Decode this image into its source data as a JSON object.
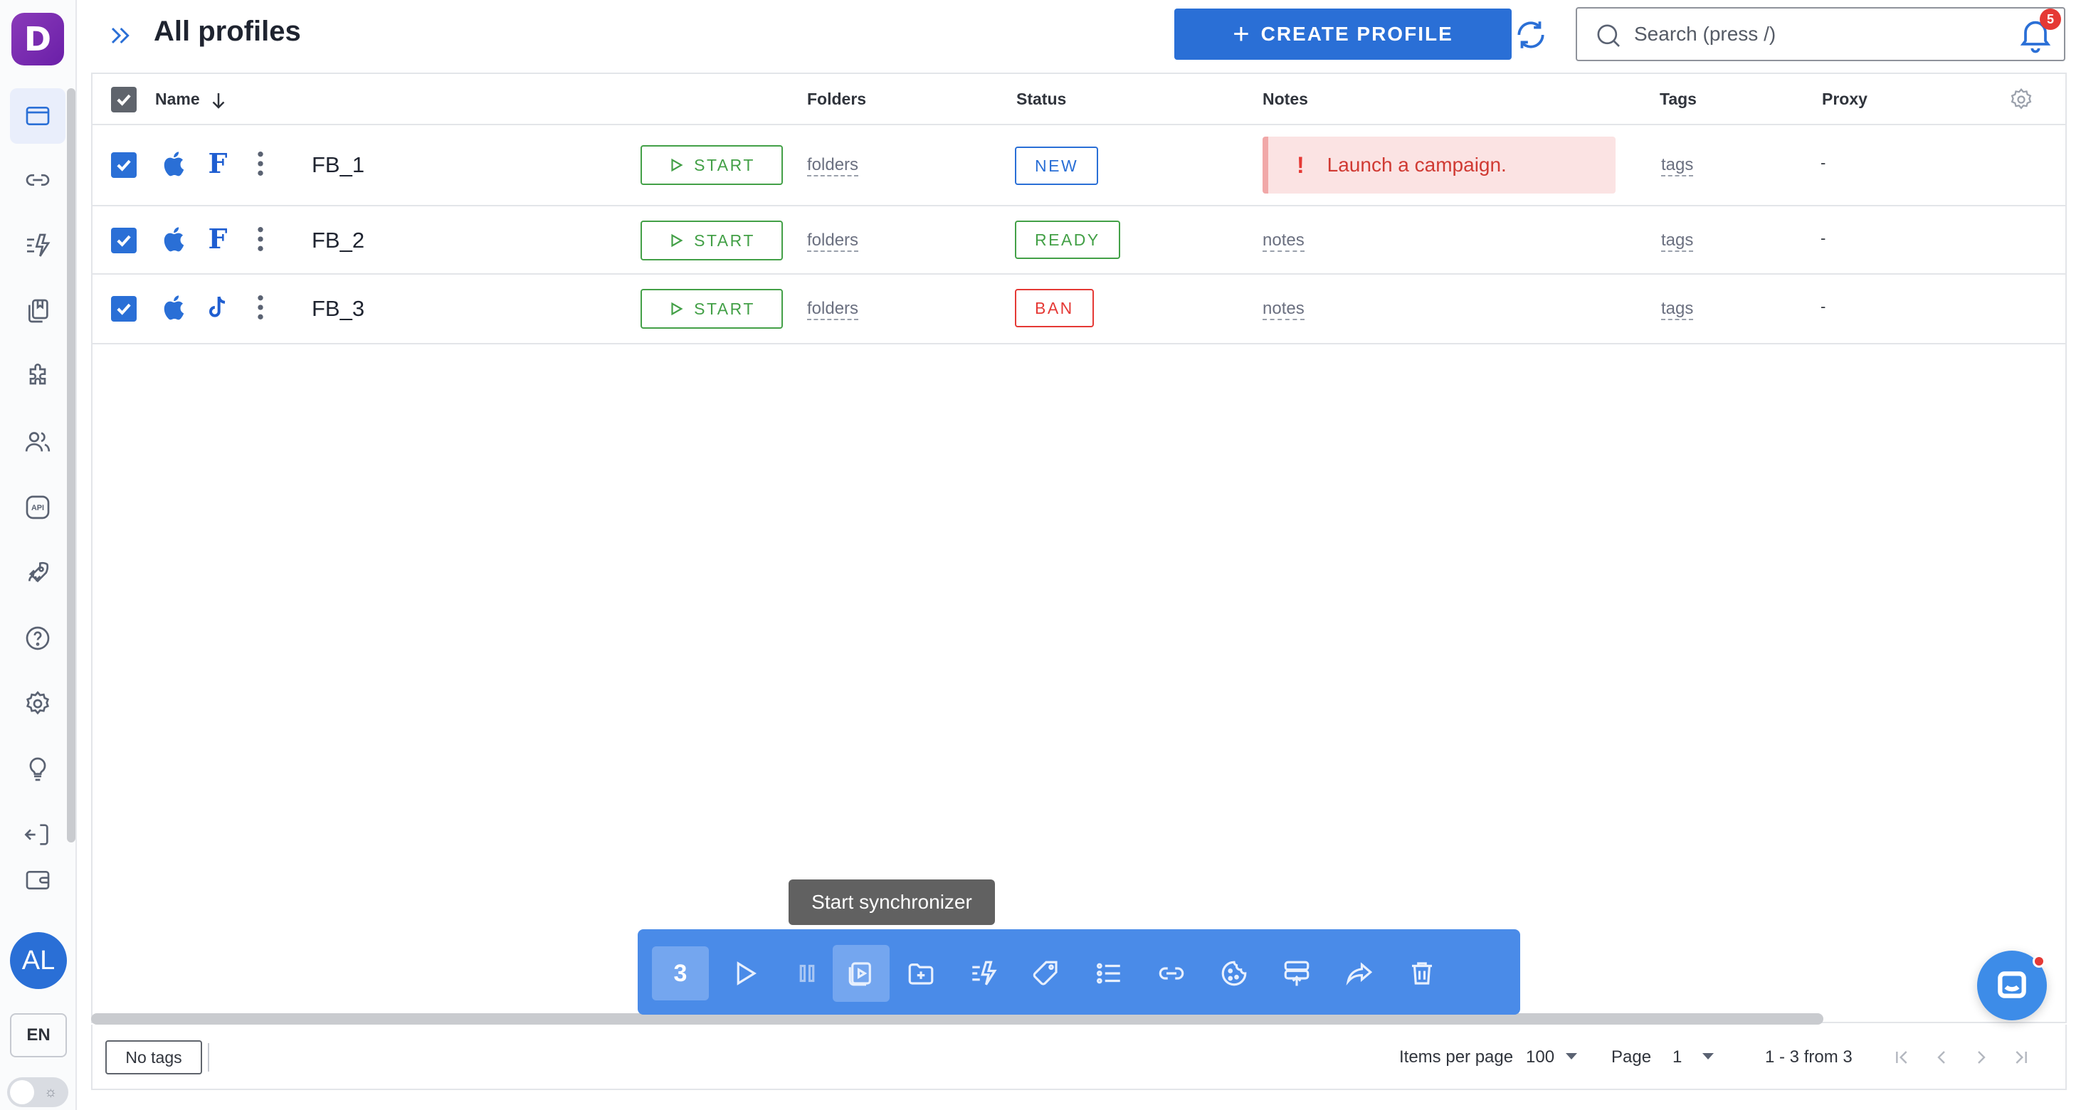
{
  "header": {
    "title": "All profiles",
    "create_button": "CREATE PROFILE",
    "search_placeholder": "Search (press /)",
    "notifications_count": "5"
  },
  "sidebar": {
    "logo": "D",
    "items": [
      "profiles-icon",
      "link-icon",
      "automation-icon",
      "templates-icon",
      "extensions-icon",
      "team-icon",
      "api-icon",
      "rocket-icon",
      "help-icon",
      "settings-icon",
      "lightbulb-icon",
      "logout-icon",
      "wallet-icon"
    ],
    "api_label": "API",
    "avatar": "AL",
    "language": "EN"
  },
  "table": {
    "columns": {
      "name": "Name",
      "folders": "Folders",
      "status": "Status",
      "notes": "Notes",
      "tags": "Tags",
      "proxy": "Proxy"
    },
    "rows": [
      {
        "name": "FB_1",
        "platform": "apple-icon",
        "social": "F",
        "start": "START",
        "folders": "folders",
        "status": "NEW",
        "status_color": "#2a6fd6",
        "note": "Launch a campaign.",
        "note_type": "alert",
        "tags": "tags",
        "proxy": "-"
      },
      {
        "name": "FB_2",
        "platform": "apple-icon",
        "social": "F",
        "start": "START",
        "folders": "folders",
        "status": "READY",
        "status_color": "#43a047",
        "note": "notes",
        "note_type": "link",
        "tags": "tags",
        "proxy": "-"
      },
      {
        "name": "FB_3",
        "platform": "apple-icon",
        "social": "tiktok-icon",
        "start": "START",
        "folders": "folders",
        "status": "BAN",
        "status_color": "#e53935",
        "note": "notes",
        "note_type": "link",
        "tags": "tags",
        "proxy": "-"
      }
    ]
  },
  "bulk_actions": {
    "selected_count": "3",
    "tooltip": "Start synchronizer",
    "actions": [
      "start-icon",
      "pause-icon",
      "synchronizer-icon",
      "add-to-folder-icon",
      "automation-icon",
      "tag-icon",
      "list-icon",
      "link-icon",
      "cookie-icon",
      "transfer-icon",
      "share-icon",
      "delete-icon"
    ]
  },
  "footer": {
    "no_tags": "No tags",
    "items_per_page_label": "Items per page",
    "items_per_page": "100",
    "page_label": "Page",
    "page": "1",
    "range": "1 - 3 from 3"
  },
  "colors": {
    "accent": "#2a6fd6",
    "start_green": "#43a047",
    "alert_red": "#e53935",
    "action_bar": "#4a8be8"
  }
}
